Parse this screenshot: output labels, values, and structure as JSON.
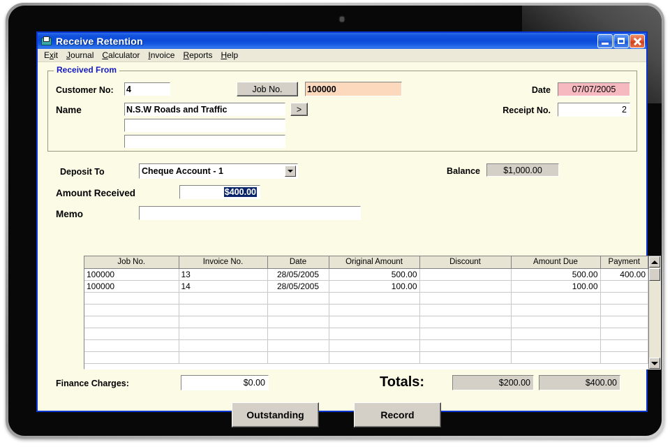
{
  "window": {
    "title": "Receive Retention",
    "icon": "folder-document-icon",
    "controls": {
      "minimize": "minimize-button",
      "maximize": "maximize-button",
      "close": "close-button"
    },
    "colors": {
      "titlebar_blue": "#0b4ad9",
      "window_border": "#0a35ce",
      "client_cream": "#fbfbe6",
      "menubar": "#ece9d8",
      "group_label_blue": "#1318c4",
      "readonly_gray": "#d4d0c8",
      "job_field_peach": "#fcd9bd",
      "date_field_pink": "#f5b9bf",
      "selection_blue": "#0a246a"
    }
  },
  "menu": [
    {
      "label": "Exit",
      "pre": "E",
      "accel": "x",
      "post": "it"
    },
    {
      "label": "Journal",
      "pre": "",
      "accel": "J",
      "post": "ournal"
    },
    {
      "label": "Calculator",
      "pre": "",
      "accel": "C",
      "post": "alculator"
    },
    {
      "label": "Invoice",
      "pre": "",
      "accel": "I",
      "post": "nvoice"
    },
    {
      "label": "Reports",
      "pre": "",
      "accel": "R",
      "post": "eports"
    },
    {
      "label": "Help",
      "pre": "",
      "accel": "H",
      "post": "elp"
    }
  ],
  "received_from": {
    "group_title": "Received From",
    "customer_no_label": "Customer No:",
    "customer_no_value": "4",
    "job_no_button": "Job No.",
    "job_no_value": "100000",
    "name_label": "Name",
    "name_value": "N.S.W Roads and Traffic",
    "name_line2": "",
    "name_line3": "",
    "name_lookup_button": ">",
    "date_label": "Date",
    "date_value": "07/07/2005",
    "receipt_no_label": "Receipt No.",
    "receipt_no_value": "2"
  },
  "payment": {
    "deposit_to_label": "Deposit To",
    "deposit_to_value": "Cheque Account - 1",
    "balance_label": "Balance",
    "balance_value": "$1,000.00",
    "amount_received_label": "Amount Received",
    "amount_received_value": "$400.00",
    "memo_label": "Memo",
    "memo_value": ""
  },
  "grid": {
    "columns": [
      "Job No.",
      "Invoice No.",
      "Date",
      "Original Amount",
      "Discount",
      "Amount Due",
      "Payment"
    ],
    "rows": [
      {
        "job_no": "100000",
        "invoice_no": "13",
        "date": "28/05/2005",
        "original_amount": "500.00",
        "discount": "",
        "amount_due": "500.00",
        "payment": "400.00"
      },
      {
        "job_no": "100000",
        "invoice_no": "14",
        "date": "28/05/2005",
        "original_amount": "100.00",
        "discount": "",
        "amount_due": "100.00",
        "payment": ""
      },
      {
        "job_no": "",
        "invoice_no": "",
        "date": "",
        "original_amount": "",
        "discount": "",
        "amount_due": "",
        "payment": ""
      },
      {
        "job_no": "",
        "invoice_no": "",
        "date": "",
        "original_amount": "",
        "discount": "",
        "amount_due": "",
        "payment": ""
      },
      {
        "job_no": "",
        "invoice_no": "",
        "date": "",
        "original_amount": "",
        "discount": "",
        "amount_due": "",
        "payment": ""
      },
      {
        "job_no": "",
        "invoice_no": "",
        "date": "",
        "original_amount": "",
        "discount": "",
        "amount_due": "",
        "payment": ""
      },
      {
        "job_no": "",
        "invoice_no": "",
        "date": "",
        "original_amount": "",
        "discount": "",
        "amount_due": "",
        "payment": ""
      },
      {
        "job_no": "",
        "invoice_no": "",
        "date": "",
        "original_amount": "",
        "discount": "",
        "amount_due": "",
        "payment": ""
      }
    ],
    "scrollbar": {
      "up": "scroll-up-arrow",
      "down": "scroll-down-arrow"
    }
  },
  "footer": {
    "finance_charges_label": "Finance Charges:",
    "finance_charges_value": "$0.00",
    "totals_label": "Totals:",
    "totals_due_value": "$200.00",
    "totals_payment_value": "$400.00",
    "outstanding_button": "Outstanding",
    "record_button": "Record"
  }
}
